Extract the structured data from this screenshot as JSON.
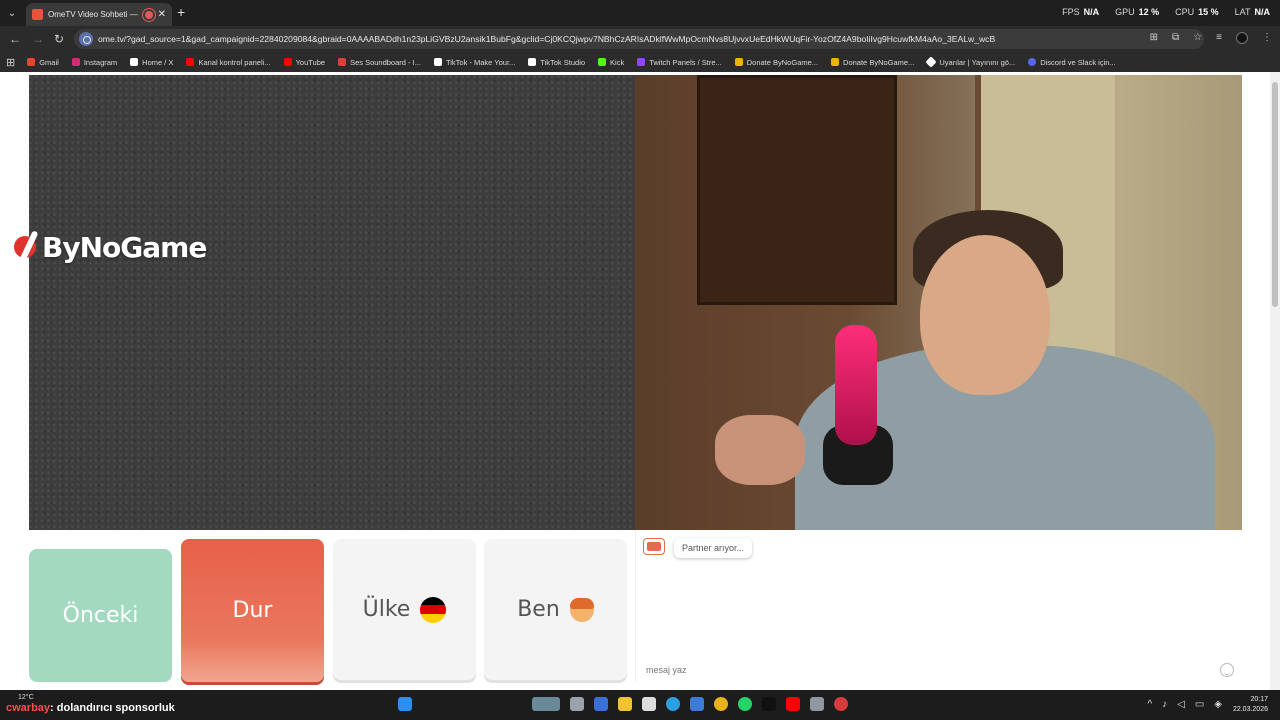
{
  "browser": {
    "tab": {
      "title": "OmeTV Video Sohbeti — O",
      "close": "✕"
    },
    "new_tab": "+",
    "perf": [
      {
        "label": "FPS",
        "value": "N/A"
      },
      {
        "label": "GPU",
        "value": "12 %"
      },
      {
        "label": "CPU",
        "value": "15 %"
      },
      {
        "label": "LAT",
        "value": "N/A"
      }
    ],
    "url": "ome.tv/?gad_source=1&gad_campaignid=22840209084&gbraid=0AAAABADdh1n23pLiGVBzU2ansik1BubFg&gclid=Cj0KCQjwpv7NBhCzARIsADklfWwMpOcmNvs8UjvvxUeEdHkWUqFir-YozOfZ4A9boIiIvg9HcuwfkM4aAo_3EALw_wcB",
    "bookmarks": [
      {
        "label": "Gmail",
        "color": "#ea4335"
      },
      {
        "label": "Instagram",
        "color": "#d62976"
      },
      {
        "label": "Home / X",
        "color": "#ffffff"
      },
      {
        "label": "Kanal kontrol paneli...",
        "color": "#ff0000"
      },
      {
        "label": "YouTube",
        "color": "#ff0000"
      },
      {
        "label": "Ses Soundboard - I...",
        "color": "#e23b3b"
      },
      {
        "label": "TikTok - Make Your...",
        "color": "#ffffff"
      },
      {
        "label": "TikTok Studio",
        "color": "#ffffff"
      },
      {
        "label": "Kick",
        "color": "#53fc18"
      },
      {
        "label": "Twitch Panels / Stre...",
        "color": "#9146ff"
      },
      {
        "label": "Donate ByNoGame...",
        "color": "#f0b400"
      },
      {
        "label": "Donate ByNoGame...",
        "color": "#f0b400"
      },
      {
        "label": "Uyarılar | Yayınını gö...",
        "color": "#ffffff"
      },
      {
        "label": "Discord ve Slack için...",
        "color": "#5865f2"
      }
    ]
  },
  "overlay": {
    "logo_text": "ByNoGame"
  },
  "controls": {
    "prev": "Önceki",
    "stop": "Dur",
    "country": "Ülke",
    "me": "Ben"
  },
  "chat": {
    "status": "Partner arıyor...",
    "placeholder": "mesaj yaz"
  },
  "taskbar": {
    "weather": "12°C",
    "ticker_name": "cwarbay",
    "ticker_text": ": dolandırıcı sponsorluk",
    "time": "20:17",
    "date": "22.03.2026"
  },
  "colors": {
    "stop_button": "#e8604a",
    "prev_button": "#a3d9bf",
    "brand_red": "#e2322d"
  }
}
